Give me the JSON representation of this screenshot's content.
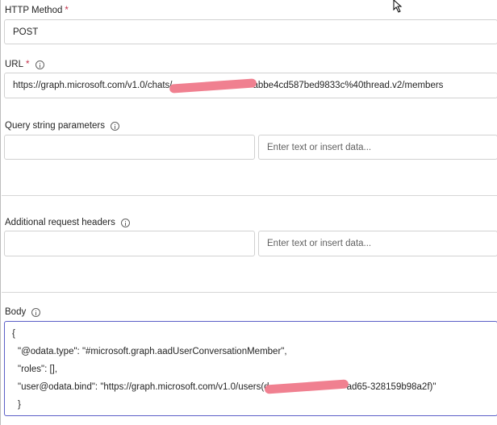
{
  "http_method": {
    "label": "HTTP Method",
    "required_mark": "*",
    "value": "POST"
  },
  "url": {
    "label": "URL",
    "required_mark": "*",
    "value_start": "https://graph.microsoft.com/v1.0/chats/",
    "value_end": "abbe4cd587bed9833c%40thread.v2/members"
  },
  "query_params": {
    "label": "Query string parameters",
    "value_placeholder": "Enter text or insert data..."
  },
  "request_headers": {
    "label": "Additional request headers",
    "value_placeholder": "Enter text or insert data..."
  },
  "body": {
    "label": "Body",
    "lines": [
      "{",
      "\"@odata.type\": \"#microsoft.graph.aadUserConversationMember\",",
      "\"roles\": [],",
      "\"user@odata.bind\": \"https://graph.microsoft.com/v1.0/users(d",
      "}"
    ],
    "line4_end": "ad65-328159b98a2f)\""
  },
  "colors": {
    "required": "#c4314b",
    "focus_border": "#5b5fc7",
    "redaction": "#f08090"
  }
}
